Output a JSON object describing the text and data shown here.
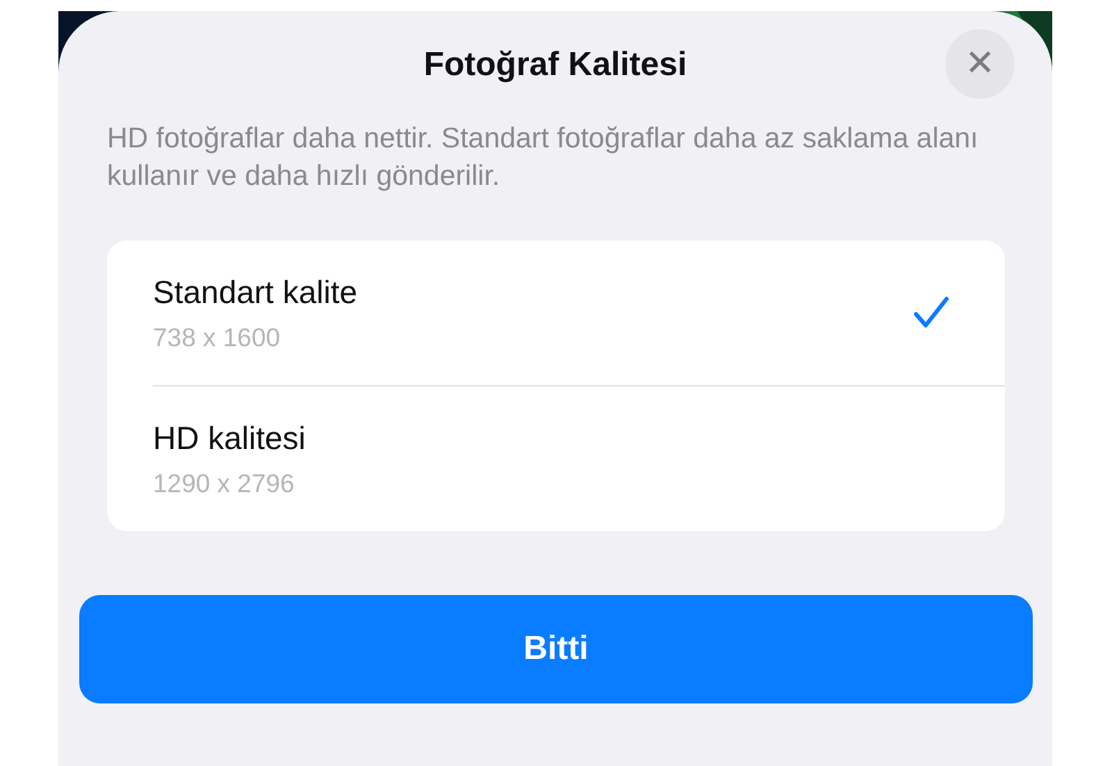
{
  "sheet": {
    "title": "Fotoğraf Kalitesi",
    "close": "✕",
    "description": "HD fotoğraflar daha nettir. Standart fotoğraflar daha az saklama alanı kullanır ve daha hızlı gönderilir."
  },
  "options": [
    {
      "label": "Standart kalite",
      "resolution": "738 x 1600",
      "selected": true
    },
    {
      "label": "HD kalitesi",
      "resolution": "1290 x 2796",
      "selected": false
    }
  ],
  "done_button": "Bitti"
}
